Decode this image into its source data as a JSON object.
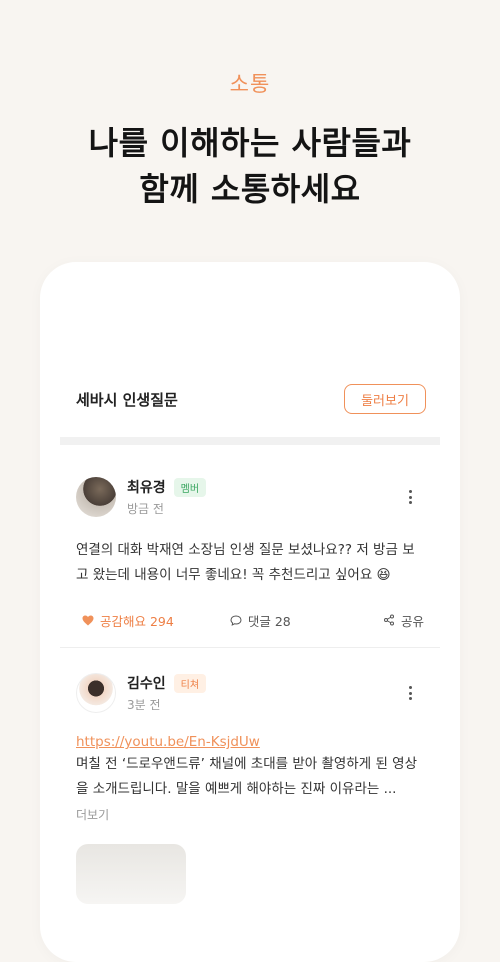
{
  "hero": {
    "eyebrow": "소통",
    "headline_line1": "나를 이해하는 사람들과",
    "headline_line2": "함께 소통하세요"
  },
  "section": {
    "title": "세바시 인생질문",
    "browse_label": "둘러보기"
  },
  "posts": [
    {
      "author": "최유경",
      "badge": "멤버",
      "time": "방금 전",
      "body": "연결의 대화 박재연 소장님 인생 질문 보셨나요?? 저 방금 보고 왔는데 내용이 너무 좋네요! 꼭 추천드리고 싶어요 😆",
      "likes_label": "공감해요 294",
      "comments_label": "댓글 28",
      "share_label": "공유"
    },
    {
      "author": "김수인",
      "badge": "티쳐",
      "time": "3분 전",
      "link": "https://youtu.be/En-KsjdUw",
      "body": "며칠 전 ‘드로우앤드류’ 채널에 초대를 받아 촬영하게 된 영상을 소개드립니다. 말을 예쁘게 해야하는 진짜 이유라는 ...",
      "more_label": "더보기"
    }
  ],
  "colors": {
    "accent": "#f0915a",
    "member_badge": "#3aa660",
    "background": "#f8f5f1"
  },
  "icons": {
    "more": "more-vertical-icon",
    "like": "heart-icon",
    "comment": "chat-bubble-icon",
    "share": "share-icon"
  }
}
